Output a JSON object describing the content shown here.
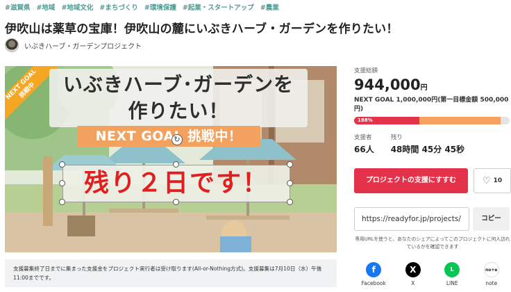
{
  "tags": [
    "#滋賀県",
    "#地域",
    "#地域文化",
    "#まちづくり",
    "#環境保護",
    "#起業・スタートアップ",
    "#農業"
  ],
  "title": "伊吹山は薬草の宝庫！伊吹山の麓にいぶきハーブ・ガーデンを作りたい！",
  "owner": "いぶきハーブ・ガーデンプロジェクト",
  "hero": {
    "ribbon_line1": "NEXT GOAL",
    "ribbon_line2": "挑戦中",
    "title_line1": "いぶきハーブ･ガーデンを",
    "title_line2": "作りたい！",
    "next_goal_banner": "NEXT GOAL 挑戦中！",
    "remaining": "残り２日です！"
  },
  "notice": "支援募集終了日までに集まった支援金をプロジェクト実行者は受け取ります(All-or-Nothing方式)。支援募集は7月10日（水）午後11:00までです。",
  "stats": {
    "total_label": "支援総額",
    "amount": "944,000",
    "currency": "円",
    "goal_text": "NEXT GOAL 1,000,000円(第一目標金額 500,000円)",
    "percent_label": "188%",
    "progress_fraction": 0.944,
    "supporters_label": "支援者",
    "supporters": "66人",
    "remaining_label": "残り",
    "remaining_time": "48時間 45分 45秒"
  },
  "actions": {
    "support_label": "プロジェクトの支援にすすむ",
    "favorite_count": "10"
  },
  "share_url": {
    "value": "https://readyfor.jp/projects/",
    "copy_label": "コピー",
    "help": "専用URLを使うと、あなたのシェアによってこのプロジェクトに何人訪れているかを確認できます"
  },
  "share": [
    {
      "name": "Facebook",
      "icon": "facebook-icon",
      "glyph": "f",
      "color": "#1877f2"
    },
    {
      "name": "X",
      "icon": "x-icon",
      "glyph": "X",
      "color": "#000000"
    },
    {
      "name": "LINE",
      "icon": "line-icon",
      "glyph": "L",
      "color": "#06c755"
    },
    {
      "name": "note",
      "icon": "note-icon",
      "glyph": "no+e",
      "color": "#ffffff"
    }
  ],
  "colors": {
    "accent": "#e5324b",
    "tag": "#4d9c94",
    "progress": "#f6a15f"
  }
}
